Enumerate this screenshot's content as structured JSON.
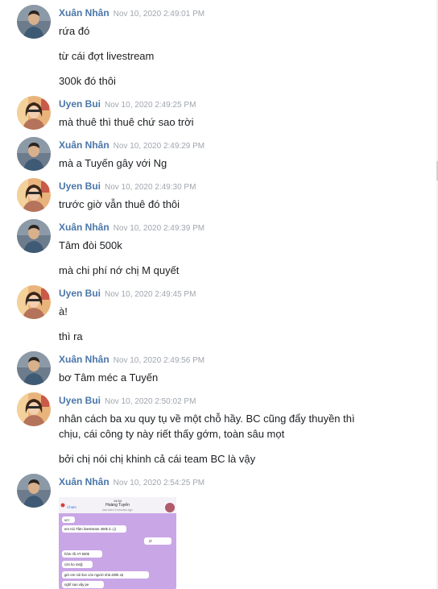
{
  "messages": [
    {
      "sender": "Xuân Nhân",
      "time": "Nov 10, 2020 2:49:01 PM",
      "lines": [
        "rứa đó",
        "từ cái đợt livestream",
        "300k đó thôi"
      ]
    },
    {
      "sender": "Uyen Bui",
      "time": "Nov 10, 2020 2:49:25 PM",
      "lines": [
        "mà thuê thì thuê chứ sao trời"
      ]
    },
    {
      "sender": "Xuân Nhân",
      "time": "Nov 10, 2020 2:49:29 PM",
      "lines": [
        "mà a Tuyến gây với Ng"
      ]
    },
    {
      "sender": "Uyen Bui",
      "time": "Nov 10, 2020 2:49:30 PM",
      "lines": [
        "trước giờ vẫn thuê đó thôi"
      ]
    },
    {
      "sender": "Xuân Nhân",
      "time": "Nov 10, 2020 2:49:39 PM",
      "lines": [
        "Tâm đòi 500k",
        "mà chi phí nớ chị M quyết"
      ]
    },
    {
      "sender": "Uyen Bui",
      "time": "Nov 10, 2020 2:49:45 PM",
      "lines": [
        "à!",
        "thì ra"
      ]
    },
    {
      "sender": "Xuân Nhân",
      "time": "Nov 10, 2020 2:49:56 PM",
      "lines": [
        "bơ Tâm méc a Tuyến"
      ]
    },
    {
      "sender": "Uyen Bui",
      "time": "Nov 10, 2020 2:50:02 PM",
      "lines": [
        "nhân cách ba xu quy tụ về một chỗ hầy. BC cũng đẩy thuyền thì chịu, cái công ty này riết thấy gớm, toàn sâu mọt",
        "bởi chị nói chị khinh cả cái team BC là vậy"
      ]
    },
    {
      "sender": "Xuân Nhân",
      "time": "Nov 10, 2020 2:54:25 PM",
      "lines": []
    }
  ],
  "shared_image": {
    "status_time": "14:54",
    "back_label": "Chats",
    "contact_name": "Hoàng Tuyến",
    "contact_status": "last seen 2 minutes ago",
    "bubbles": [
      "vc!",
      "em nói Tâm livestream 400k à =))",
      "Ừ",
      "hôm rồi AT 500k",
      "còn ko rang̃",
      "giờ em nói live còn người nhả 400k xịt",
      "nghĩ sao vậy pe"
    ]
  },
  "colors": {
    "sender_name": "#4a76a8",
    "timestamp": "#a0a6ae",
    "message_text": "#1c1e21",
    "image_background": "#c9a6e6"
  },
  "icons": {
    "avatar_xuan": "man-avatar",
    "avatar_uyen": "woman-avatar"
  }
}
